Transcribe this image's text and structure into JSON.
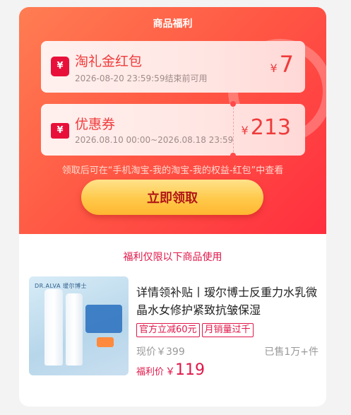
{
  "header": {
    "title": "商品福利"
  },
  "coupons": [
    {
      "icon": "red-envelope-icon",
      "icon_glyph": "¥",
      "name": "淘礼金红包",
      "subtitle": "2026-08-20 23:59:59结束前可用",
      "currency": "¥",
      "amount": "7"
    },
    {
      "icon": "ticket-icon",
      "icon_glyph": "¥",
      "name": "优惠券",
      "subtitle": "2026.08.10 00:00~2026.08.18 23:59",
      "currency": "¥",
      "amount": "213"
    }
  ],
  "hint": "领取后可在“手机淘宝-我的淘宝-我的权益-红包”中查看",
  "claim_button": "立即领取",
  "section_title": "福利仅限以下商品使用",
  "product": {
    "title": "详情领补贴丨瑷尔博士反重力水乳微晶水女修护紧致抗皱保湿",
    "tags": [
      "官方立减60元",
      "月销量过千"
    ],
    "original_price": "现价￥399",
    "sold": "已售1万+件",
    "final_label": "福利价",
    "final_currency": "￥",
    "final_price": "119",
    "image_brand": "DR.ALVA 瑷尔博士"
  },
  "colors": {
    "accent": "#e0174a",
    "coupon_text": "#ef3b3b",
    "button_text": "#b01717",
    "header_gradient_start": "#ff7d52",
    "header_gradient_end": "#ff2e3f"
  }
}
